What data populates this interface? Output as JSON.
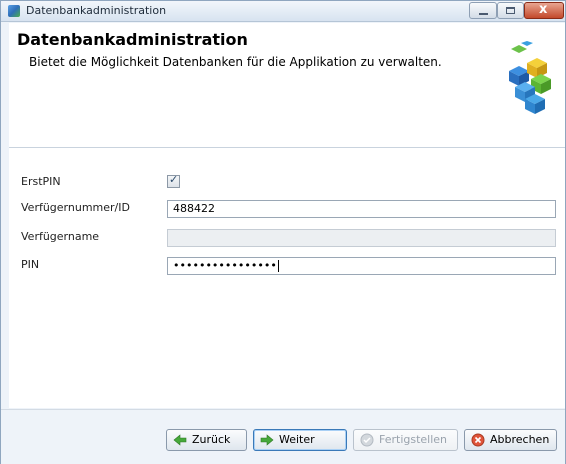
{
  "window": {
    "title": "Datenbankadministration",
    "close_symbol": "x"
  },
  "header": {
    "title": "Datenbankadministration",
    "description": "Bietet die Möglichkeit Datenbanken für die Applikation zu verwalten."
  },
  "form": {
    "erstpin": {
      "label": "ErstPIN",
      "checked": true,
      "check_glyph": "✓"
    },
    "verfuegernummer": {
      "label": "Verfügernummer/ID",
      "value": "488422"
    },
    "verfuegername": {
      "label": "Verfügername",
      "value": ""
    },
    "pin": {
      "label": "PIN",
      "value": "••••••••••••••••"
    }
  },
  "buttons": {
    "back": "Zurück",
    "next": "Weiter",
    "finish": "Fertigstellen",
    "cancel": "Abbrechen"
  },
  "icons": {
    "app": "database-icon",
    "logo": "database-blocks-logo",
    "back": "arrow-left-icon",
    "next": "arrow-right-icon",
    "finish": "check-circle-icon",
    "cancel": "cancel-circle-icon"
  },
  "colors": {
    "accent": "#3a79b8",
    "titlebar": "#d7e3f0",
    "close": "#c3492b"
  }
}
